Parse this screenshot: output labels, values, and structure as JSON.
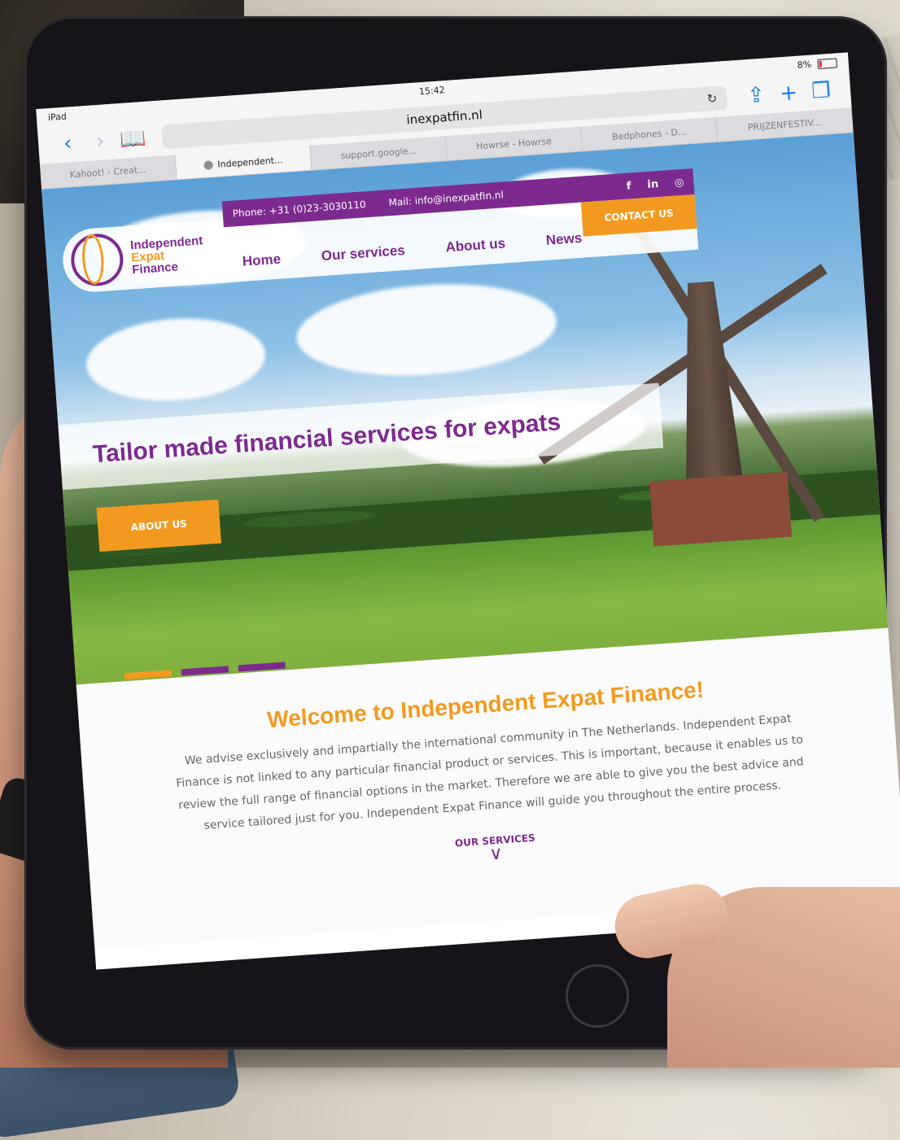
{
  "device": {
    "label": "iPad",
    "time": "15:42",
    "battery": "8%"
  },
  "browser": {
    "url": "inexpatfin.nl",
    "back_icon": "chevron-left-icon",
    "forward_icon": "chevron-right-icon",
    "bookmarks_icon": "book-icon",
    "share_icon": "share-icon",
    "new_tab_icon": "plus-icon",
    "tabs_icon": "tabs-icon",
    "tabs": [
      {
        "label": "Kahoot! - Creat..."
      },
      {
        "label": "Independent..."
      },
      {
        "label": "support.google..."
      },
      {
        "label": "Howrse - Howrse"
      },
      {
        "label": "Bedphones - D..."
      },
      {
        "label": "PRIJZENFESTIV..."
      }
    ]
  },
  "site": {
    "logo": {
      "line1": "Independent",
      "line2": "Expat",
      "line3": "Finance"
    },
    "phone": "Phone: +31 (0)23-3030110",
    "mail": "Mail: info@inexpatfin.nl",
    "social": {
      "facebook": "f",
      "linkedin": "in",
      "instagram": "◎"
    },
    "nav": [
      "Home",
      "Our services",
      "About us",
      "News"
    ],
    "contact_label": "CONTACT US",
    "hero_title": "Tailor made financial services for expats",
    "about_button": "ABOUT US",
    "slider_active": 0,
    "welcome_title": "Welcome to Independent Expat Finance!",
    "welcome_text": "We advise exclusively and impartially the international community in The Netherlands. Independent Expat Finance is not linked to any particular financial product or services. This is important, because it enables us to review the full range of financial options in the market. Therefore  we are able to give you the best advice and service tailored just for you. Independent Expat Finance will guide you throughout the entire process.",
    "services_link": "OUR SERVICES"
  },
  "colors": {
    "purple": "#7d2a8f",
    "orange": "#f29a1f",
    "ios_blue": "#1b7cf5"
  }
}
